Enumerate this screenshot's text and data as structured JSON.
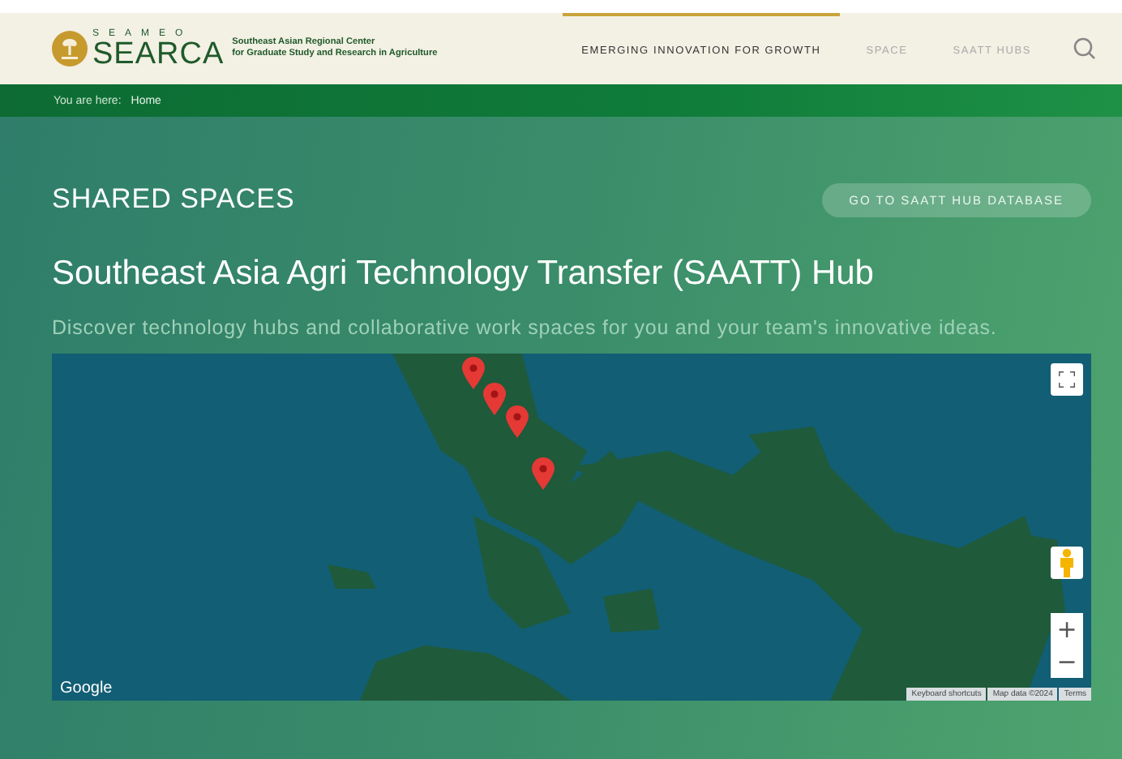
{
  "header": {
    "logo": {
      "org": "SEAMEO",
      "name": "SEARCA",
      "subtitle_1": "Southeast Asian Regional Center",
      "subtitle_2": "for Graduate Study and Research in Agriculture"
    },
    "nav": [
      {
        "label": "EMERGING INNOVATION FOR GROWTH",
        "selected": true
      },
      {
        "label": "SPACE",
        "selected": false
      },
      {
        "label": "SAATT HUBS",
        "selected": false
      }
    ]
  },
  "breadcrumb": {
    "prefix": "You are here:",
    "items": [
      "Home"
    ]
  },
  "section": {
    "title": "SHARED SPACES",
    "button": "GO TO SAATT HUB DATABASE"
  },
  "heading": "Southeast Asia Agri Technology Transfer (SAATT) Hub",
  "intro": "Discover technology hubs and collaborative work spaces for you and your team's innovative ideas.",
  "map": {
    "zoom_in": "+",
    "zoom_out": "−",
    "brand": "Google",
    "attribution": [
      "Keyboard shortcuts",
      "Map data ©2024",
      "Terms"
    ]
  }
}
